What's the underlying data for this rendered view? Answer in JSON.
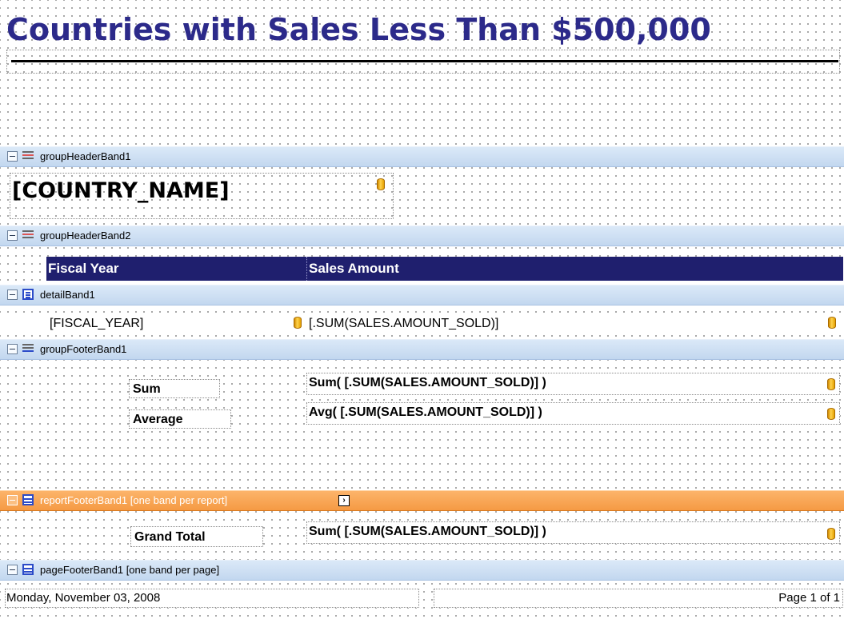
{
  "title": "Countries with Sales Less Than $500,000",
  "bands": {
    "group_header_1": "groupHeaderBand1",
    "group_header_2": "groupHeaderBand2",
    "detail": "detailBand1",
    "group_footer_1": "groupFooterBand1",
    "report_footer": "reportFooterBand1 [one band per report]",
    "page_footer": "pageFooterBand1 [one band per page]"
  },
  "country_field": "[COUNTRY_NAME]",
  "table_header": {
    "col1": "Fiscal Year",
    "col2": "Sales Amount"
  },
  "detail": {
    "fiscal_year": "[FISCAL_YEAR]",
    "amount": "[.SUM(SALES.AMOUNT_SOLD)]"
  },
  "group_footer": {
    "sum_label": "Sum",
    "sum_expr": "Sum( [.SUM(SALES.AMOUNT_SOLD)] )",
    "avg_label": "Average",
    "avg_expr": "Avg( [.SUM(SALES.AMOUNT_SOLD)] )"
  },
  "report_footer": {
    "grand_label": "Grand Total",
    "grand_expr": "Sum( [.SUM(SALES.AMOUNT_SOLD)] )"
  },
  "page_footer": {
    "date": "Monday, November 03, 2008",
    "page": "Page 1 of 1"
  },
  "colors": {
    "title": "#2c2a8a",
    "table_header_bg": "#1f1f6e",
    "band_bg": "#c2d7ef",
    "report_band_bg": "#f59a44",
    "icon_blue": "#2b4bc8"
  },
  "icons": {
    "band_collapse": "minus-box-icon",
    "group_header_1": "group-header-icon",
    "group_header_2": "group-header-icon",
    "detail": "detail-band-icon",
    "group_footer": "group-footer-icon",
    "report_footer": "report-footer-icon",
    "page_footer": "page-footer-icon",
    "database_field": "database-icon",
    "smart_tag": "smart-tag-icon"
  }
}
